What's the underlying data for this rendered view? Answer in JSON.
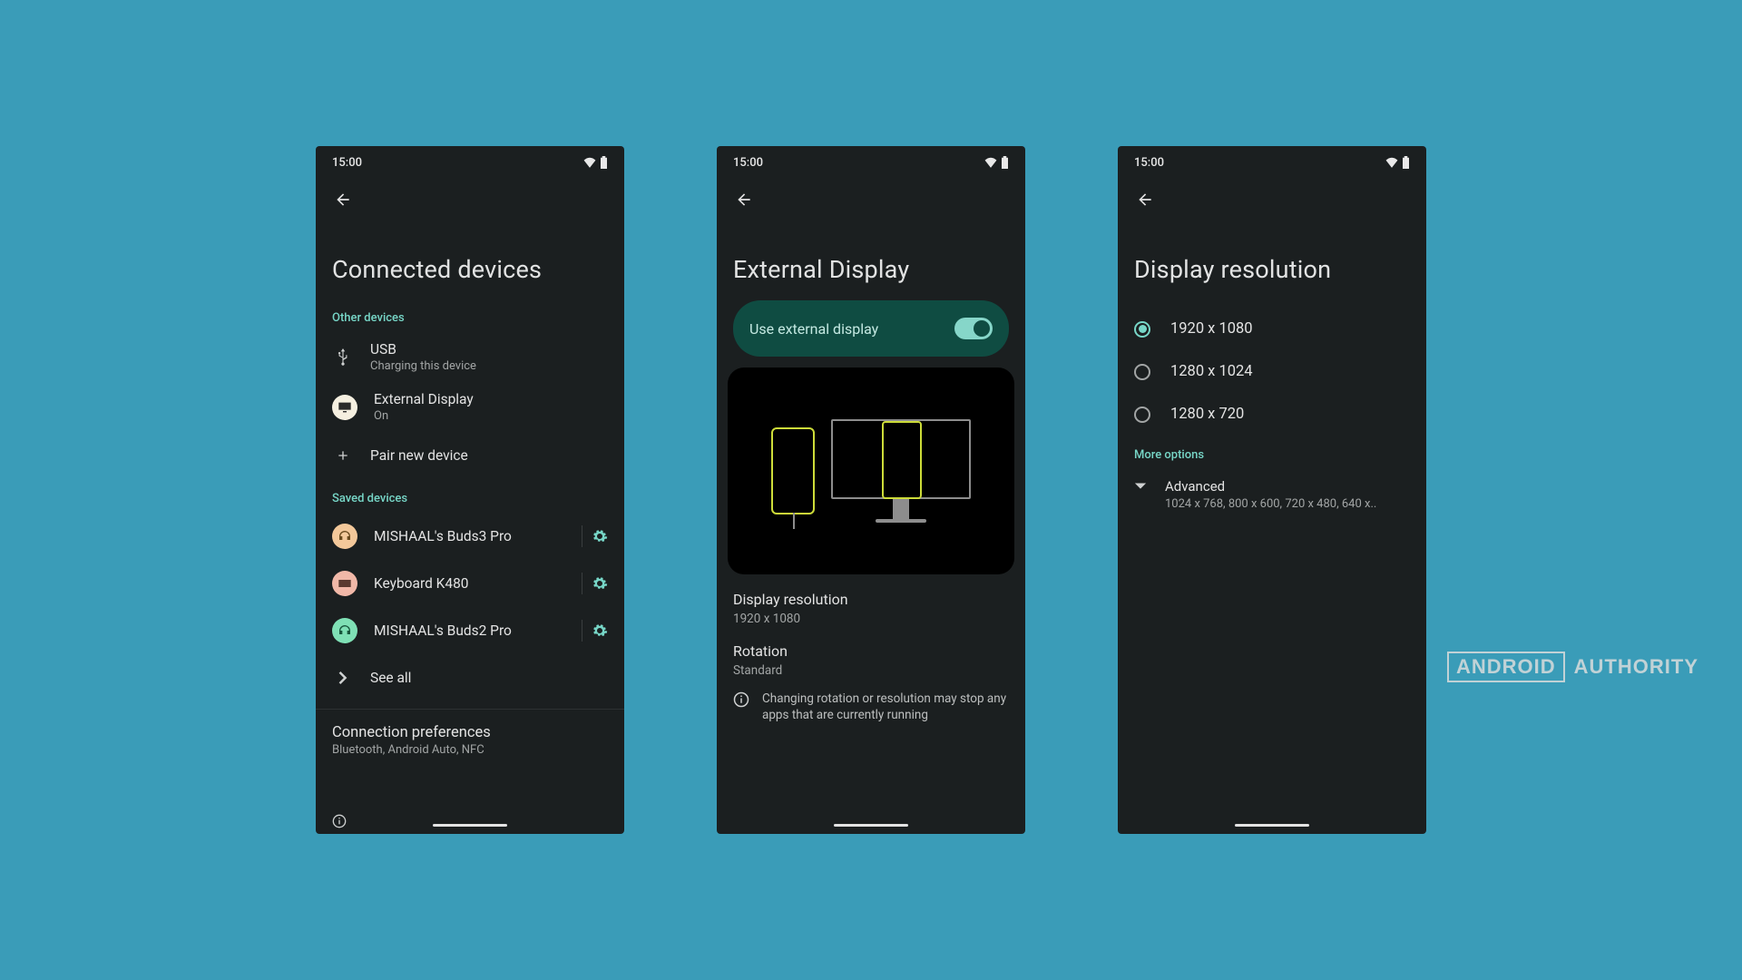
{
  "status": {
    "time": "15:00"
  },
  "watermark": {
    "a": "ANDROID",
    "b": "AUTHORITY"
  },
  "screen1": {
    "title": "Connected devices",
    "sections": {
      "other_label": "Other devices",
      "saved_label": "Saved devices"
    },
    "usb": {
      "title": "USB",
      "sub": "Charging this device"
    },
    "extDisp": {
      "title": "External Display",
      "sub": "On"
    },
    "pair": {
      "title": "Pair new device"
    },
    "saved": [
      {
        "title": "MISHAAL's Buds3 Pro"
      },
      {
        "title": "Keyboard K480"
      },
      {
        "title": "MISHAAL's Buds2 Pro"
      }
    ],
    "see_all": "See all",
    "connPref": {
      "title": "Connection preferences",
      "sub": "Bluetooth, Android Auto, NFC"
    }
  },
  "screen2": {
    "title": "External Display",
    "toggle_label": "Use external display",
    "toggle_on": true,
    "res": {
      "title": "Display resolution",
      "sub": "1920 x 1080"
    },
    "rot": {
      "title": "Rotation",
      "sub": "Standard"
    },
    "warning": "Changing rotation or resolution may stop any apps that are currently running"
  },
  "screen3": {
    "title": "Display resolution",
    "options": [
      {
        "label": "1920 x 1080",
        "selected": true
      },
      {
        "label": "1280 x 1024",
        "selected": false
      },
      {
        "label": "1280 x 720",
        "selected": false
      }
    ],
    "more_label": "More options",
    "advanced": {
      "title": "Advanced",
      "sub": "1024 x 768, 800 x 600, 720 x 480, 640 x.."
    }
  }
}
